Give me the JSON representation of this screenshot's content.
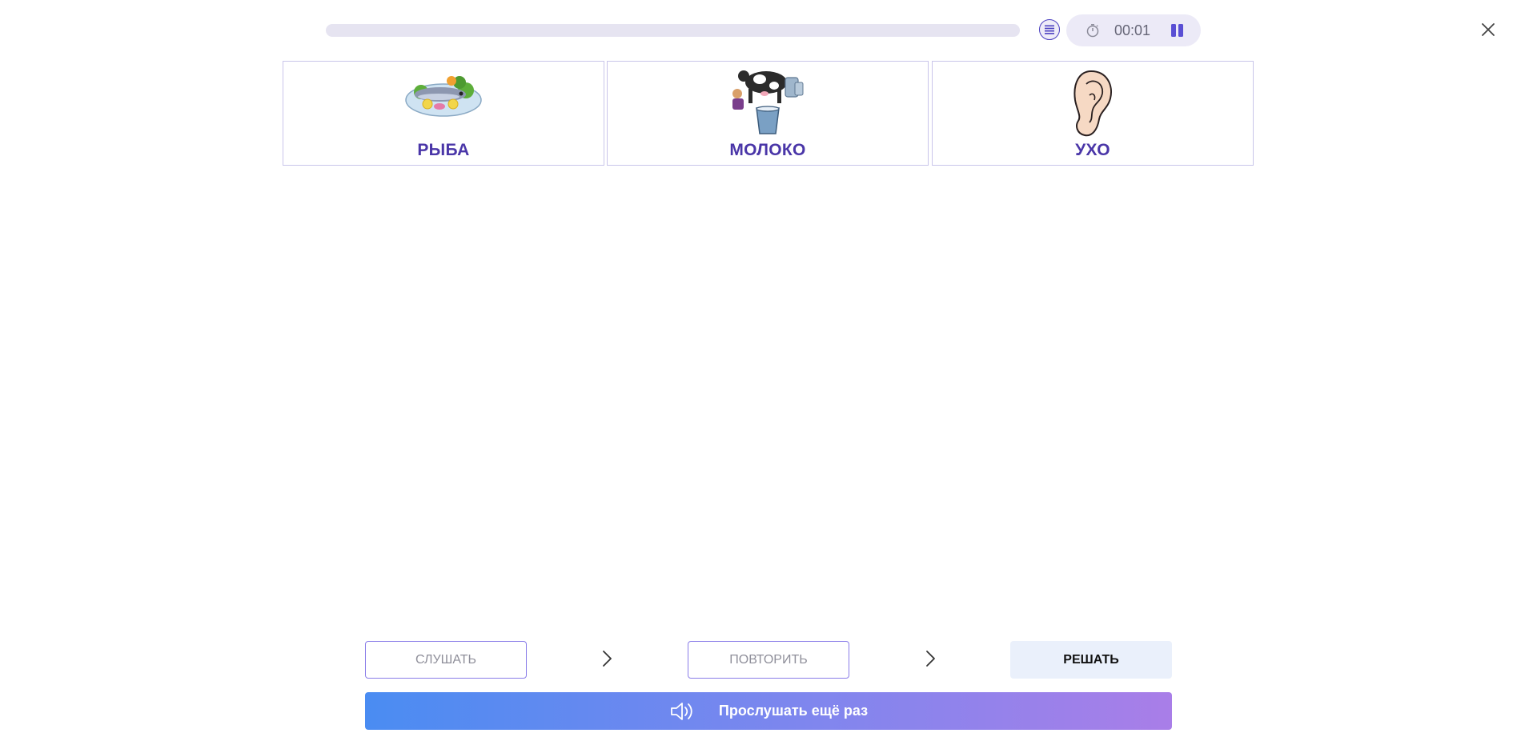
{
  "header": {
    "progress": 0,
    "timer": "00:01",
    "icons": {
      "menu": "list-icon",
      "timer": "stopwatch-icon",
      "pause": "pause-icon",
      "close": "close-icon"
    }
  },
  "cards": [
    {
      "label": "РЫБА",
      "icon": "fish-plate-image"
    },
    {
      "label": "МОЛОКО",
      "icon": "milking-cow-image"
    },
    {
      "label": "УХО",
      "icon": "ear-image"
    }
  ],
  "steps": {
    "listen": "СЛУШАТЬ",
    "repeat": "ПОВТОРИТЬ",
    "solve": "РЕШАТЬ"
  },
  "replay": {
    "label": "Прослушать ещё раз",
    "icon": "speaker-icon"
  },
  "colors": {
    "accent": "#4a36a8",
    "button_gradient_start": "#4a8cf2",
    "button_gradient_end": "#a97ee8"
  }
}
